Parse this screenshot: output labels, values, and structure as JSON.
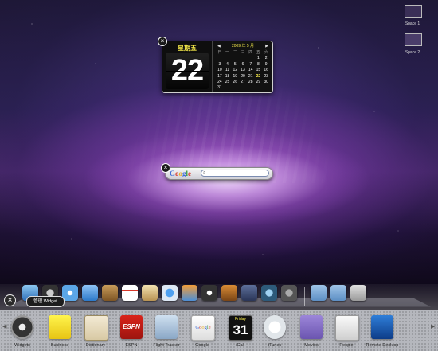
{
  "desktop": {
    "spaces": [
      {
        "label": "Space 1"
      },
      {
        "label": "Space 2"
      }
    ]
  },
  "calendar_widget": {
    "weekday": "星期五",
    "day": "22",
    "month_title": "2009 年 5 月",
    "weekday_headers": [
      "日",
      "一",
      "二",
      "三",
      "四",
      "五",
      "六"
    ],
    "days": [
      "",
      "",
      "",
      "",
      "",
      "1",
      "2",
      "3",
      "4",
      "5",
      "6",
      "7",
      "8",
      "9",
      "10",
      "11",
      "12",
      "13",
      "14",
      "15",
      "16",
      "17",
      "18",
      "19",
      "20",
      "21",
      "22",
      "23",
      "24",
      "25",
      "26",
      "27",
      "28",
      "29",
      "30",
      "31",
      "",
      "",
      "",
      "",
      "",
      ""
    ],
    "today_index": 26
  },
  "google_widget": {
    "logo": "Google",
    "search_placeholder": ""
  },
  "widget_bar": {
    "manage_label": "管理 Widget",
    "items": [
      {
        "label": "Widgets",
        "icon": "widgets-icon"
      },
      {
        "label": "Business",
        "icon": "business-icon"
      },
      {
        "label": "Dictionary",
        "icon": "dictionary-icon"
      },
      {
        "label": "ESPN",
        "icon": "espn-icon"
      },
      {
        "label": "Flight Tracker",
        "icon": "flight-tracker-icon"
      },
      {
        "label": "Google",
        "icon": "google-icon"
      },
      {
        "label": "iCal",
        "icon": "ical-icon",
        "ical_day": "Friday",
        "ical_date": "31"
      },
      {
        "label": "iTunes",
        "icon": "itunes-icon"
      },
      {
        "label": "Movies",
        "icon": "movies-icon"
      },
      {
        "label": "People",
        "icon": "people-icon"
      },
      {
        "label": "Remote Desktop",
        "icon": "remote-desktop-icon"
      }
    ]
  },
  "dock": {
    "items": [
      "finder-icon",
      "dashboard-icon",
      "safari-icon",
      "ichat-icon",
      "address-book-icon",
      "ical-icon",
      "preview-icon",
      "itunes-icon",
      "iphoto-icon",
      "imovie-icon",
      "garageband-icon",
      "spaces-icon",
      "time-machine-icon",
      "system-preferences-icon",
      "separator",
      "applications-folder-icon",
      "documents-folder-icon",
      "trash-icon"
    ]
  }
}
